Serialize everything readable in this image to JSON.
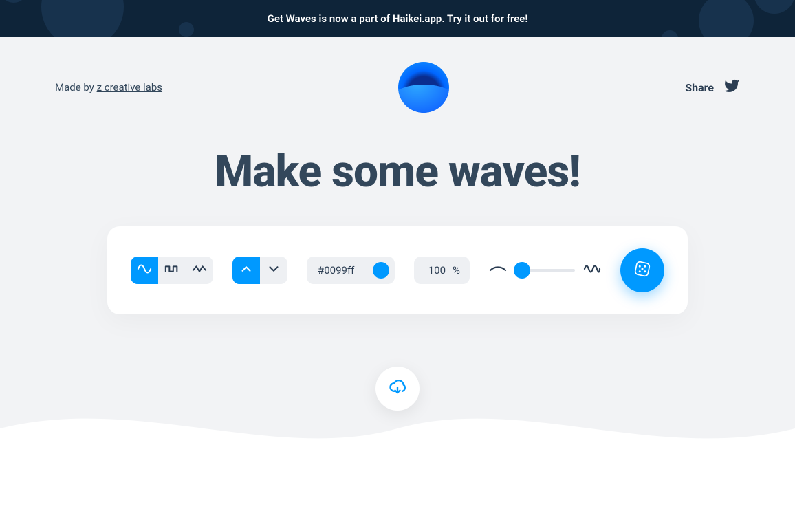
{
  "banner": {
    "prefix": "Get Waves is now a part of ",
    "link_label": "Haikei.app",
    "suffix": ". Try it out for free!"
  },
  "header": {
    "made_by_prefix": "Made by ",
    "made_by_link": "z creative labs",
    "share_label": "Share"
  },
  "title": "Make some waves!",
  "controls": {
    "wave_type": {
      "options": [
        "sine",
        "square",
        "zigzag"
      ],
      "selected": "sine"
    },
    "direction": {
      "options": [
        "up",
        "down"
      ],
      "selected": "up"
    },
    "color_hex": "#0099ff",
    "opacity_value": "100",
    "opacity_unit": "%",
    "complexity_percent": 12
  },
  "icons": {
    "twitter": "twitter-icon",
    "sine": "sine-wave-icon",
    "square": "square-wave-icon",
    "zigzag": "zigzag-wave-icon",
    "up": "chevron-up-icon",
    "down": "chevron-down-icon",
    "low": "flat-wave-icon",
    "high": "complex-wave-icon",
    "dice": "dice-icon",
    "download": "cloud-download-icon"
  },
  "colors": {
    "accent": "#0099ff",
    "banner_bg": "#0e2439",
    "text": "#33475b",
    "panel_gray": "#eef0f3"
  }
}
